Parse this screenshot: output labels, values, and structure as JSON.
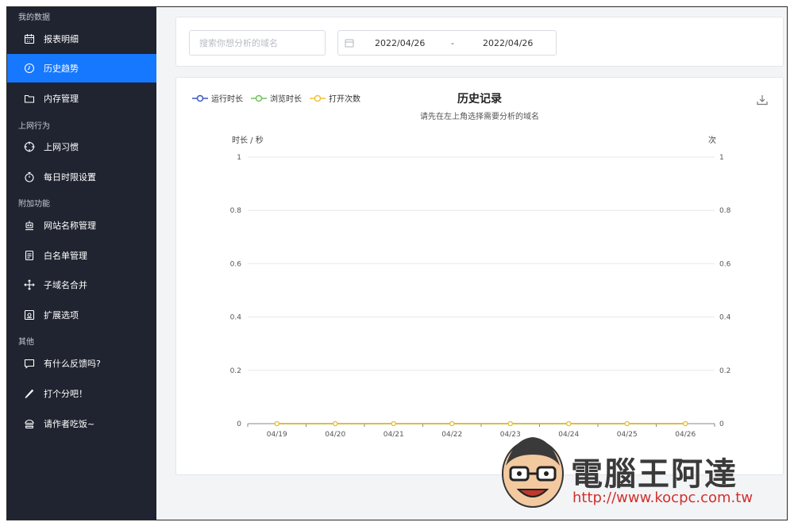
{
  "sidebar": {
    "groups": [
      {
        "label": "我的数据"
      },
      {
        "label": "上网行为"
      },
      {
        "label": "附加功能"
      },
      {
        "label": "其他"
      }
    ],
    "items": [
      {
        "label": "报表明细",
        "icon": "calendar-icon"
      },
      {
        "label": "历史趋势",
        "icon": "clock-icon",
        "active": true
      },
      {
        "label": "内存管理",
        "icon": "folder-icon"
      },
      {
        "label": "上网习惯",
        "icon": "target-icon"
      },
      {
        "label": "每日时限设置",
        "icon": "stopwatch-icon"
      },
      {
        "label": "网站名称管理",
        "icon": "robot-icon"
      },
      {
        "label": "白名单管理",
        "icon": "file-icon"
      },
      {
        "label": "子域名合并",
        "icon": "move-icon"
      },
      {
        "label": "扩展选项",
        "icon": "settings-box-icon"
      },
      {
        "label": "有什么反馈吗?",
        "icon": "comment-icon"
      },
      {
        "label": "打个分吧！",
        "icon": "pen-icon"
      },
      {
        "label": "请作者吃饭~",
        "icon": "burger-icon"
      }
    ]
  },
  "filters": {
    "search_placeholder": "搜索你想分析的域名",
    "date_start": "2022/04/26",
    "date_separator": "-",
    "date_end": "2022/04/26"
  },
  "chart_data": {
    "type": "line",
    "title": "历史记录",
    "subtitle": "请先在左上角选择需要分析的域名",
    "y_left_label": "时长 / 秒",
    "y_right_label": "次",
    "categories": [
      "04/19",
      "04/20",
      "04/21",
      "04/22",
      "04/23",
      "04/24",
      "04/25",
      "04/26"
    ],
    "y_ticks": [
      "0",
      "0.2",
      "0.4",
      "0.6",
      "0.8",
      "1"
    ],
    "ylim": [
      0,
      1
    ],
    "series": [
      {
        "name": "运行时长",
        "color": "#3a56c4",
        "values": [
          0,
          0,
          0,
          0,
          0,
          0,
          0,
          0
        ]
      },
      {
        "name": "浏览时长",
        "color": "#6cc45a",
        "values": [
          0,
          0,
          0,
          0,
          0,
          0,
          0,
          0
        ]
      },
      {
        "name": "打开次数",
        "color": "#f2c230",
        "values": [
          0,
          0,
          0,
          0,
          0,
          0,
          0,
          0
        ]
      }
    ],
    "grid": true,
    "legend_position": "top-left"
  },
  "watermark": {
    "text": "電腦王阿達",
    "url": "http://www.kocpc.com.tw"
  },
  "colors": {
    "sidebar_bg": "#1f2430",
    "accent": "#1677ff"
  }
}
